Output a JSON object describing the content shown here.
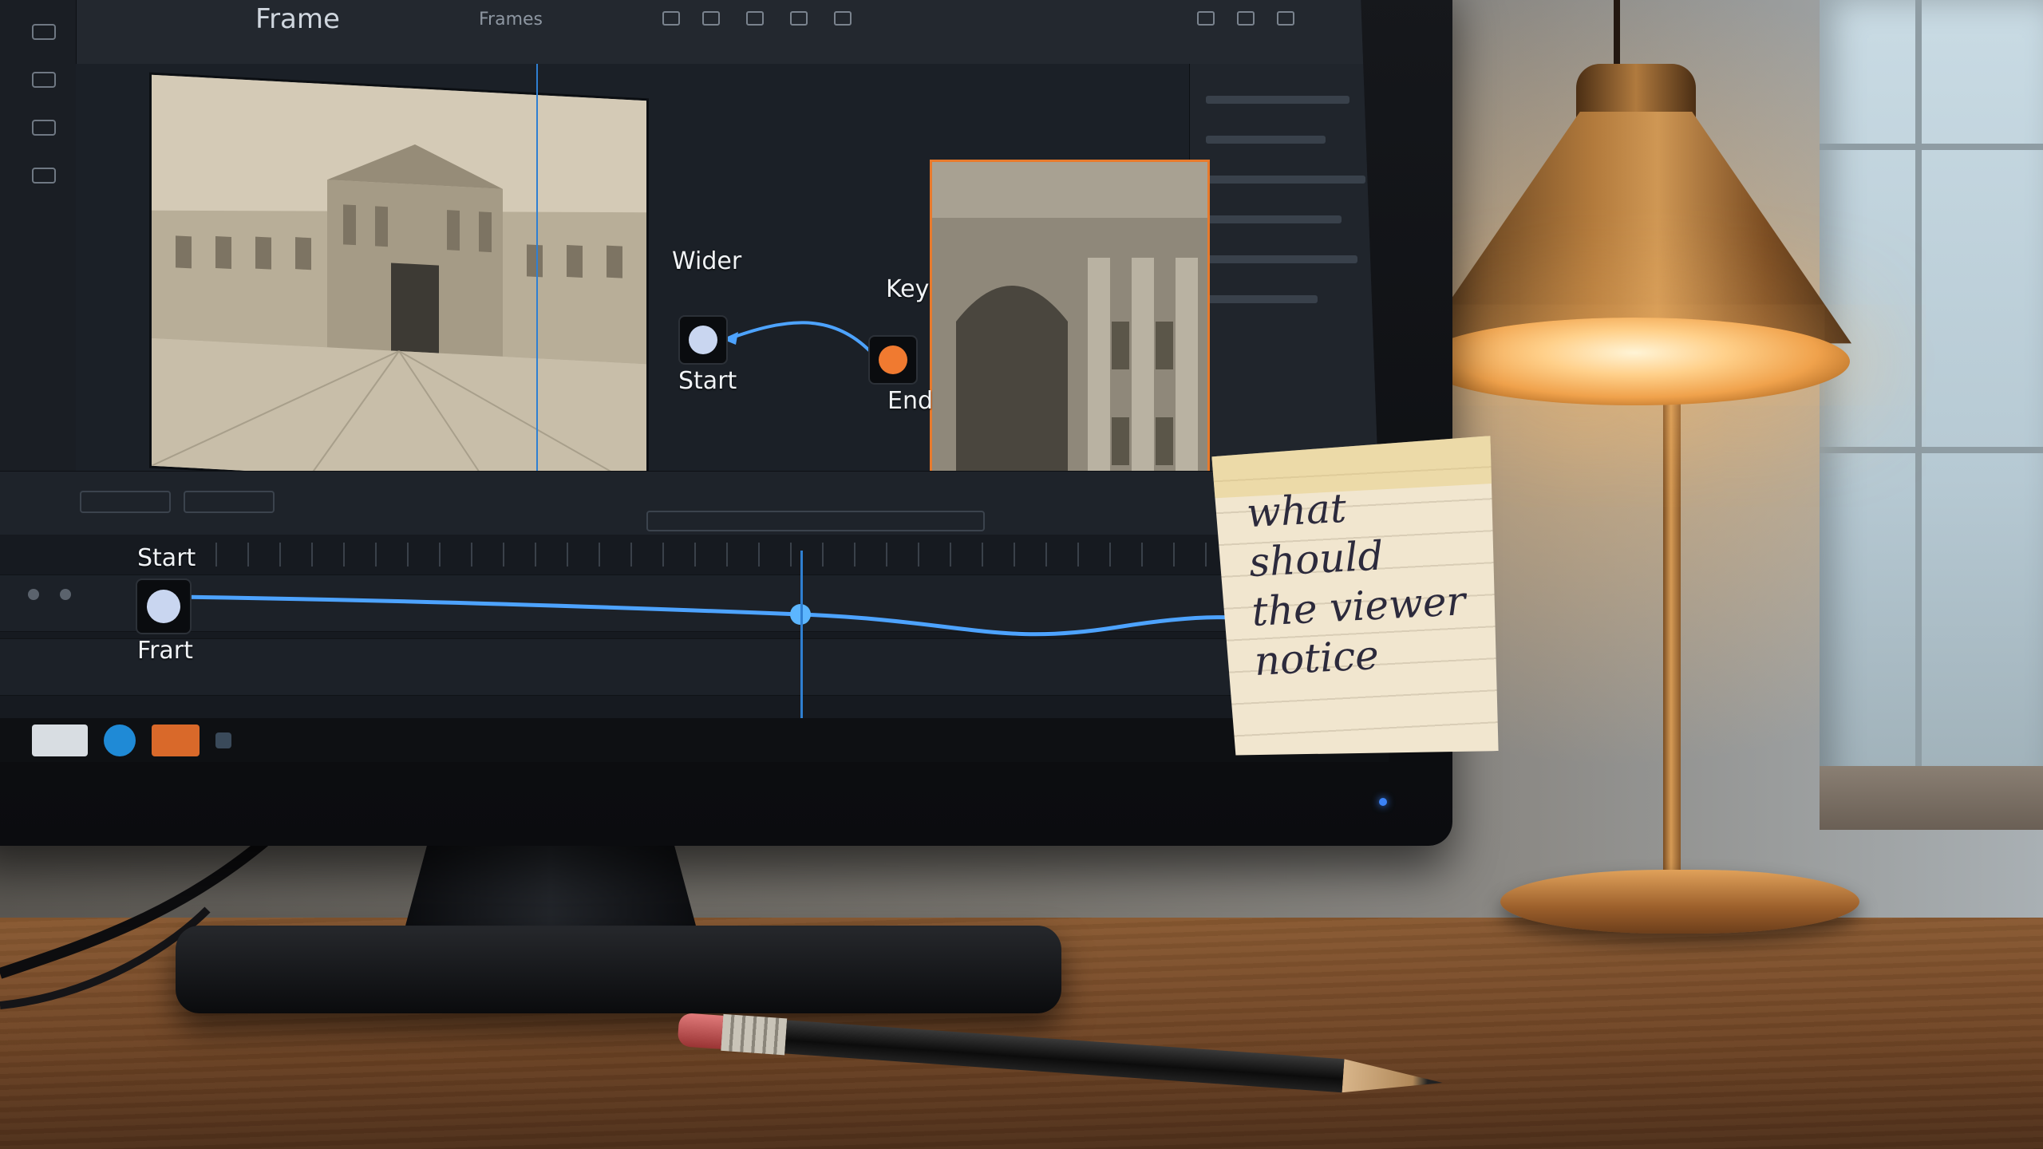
{
  "app": {
    "title": "Frame",
    "menu_label": "Frames"
  },
  "viewer": {
    "start_node": {
      "top_label": "Wider",
      "bottom_label": "Start",
      "color": "#c9d6f0"
    },
    "end_node": {
      "top_label": "Key",
      "bottom_label": "End",
      "color": "#f07a30"
    },
    "accent_color": "#2f7fd1"
  },
  "timeline": {
    "start_node": {
      "top_label": "Start",
      "bottom_label": "Frart",
      "color": "#c9d6f0"
    },
    "end_node": {
      "color": "#f07a30"
    }
  },
  "sticky_note": {
    "text": "what\nshould\nthe viewer\nnotice"
  },
  "icons": {
    "toolbar": [
      "toolbar-icon"
    ],
    "taskbar": [
      "app-icon",
      "chat-icon",
      "video-icon",
      "add-icon"
    ]
  }
}
